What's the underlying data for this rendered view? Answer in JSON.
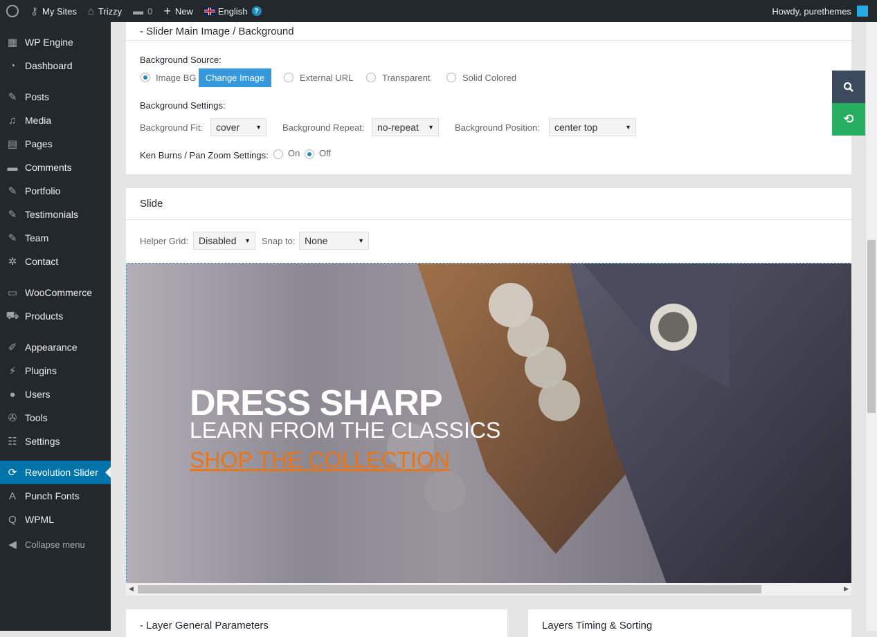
{
  "adminbar": {
    "my_sites": "My Sites",
    "site_name": "Trizzy",
    "comments_count": "0",
    "new_label": "New",
    "language": "English",
    "howdy": "Howdy, purethemes",
    "help": "?"
  },
  "sidebar": {
    "items": [
      {
        "label": "WP Engine",
        "icon": "grid-icon",
        "glyph": "▦"
      },
      {
        "label": "Dashboard",
        "icon": "dashboard-icon",
        "glyph": "◔"
      },
      {
        "label": "Posts",
        "icon": "pin-icon",
        "glyph": "✎"
      },
      {
        "label": "Media",
        "icon": "media-icon",
        "glyph": "♫"
      },
      {
        "label": "Pages",
        "icon": "page-icon",
        "glyph": "▤"
      },
      {
        "label": "Comments",
        "icon": "comment-icon",
        "glyph": "▬"
      },
      {
        "label": "Portfolio",
        "icon": "pin-icon",
        "glyph": "✎"
      },
      {
        "label": "Testimonials",
        "icon": "pin-icon",
        "glyph": "✎"
      },
      {
        "label": "Team",
        "icon": "pin-icon",
        "glyph": "✎"
      },
      {
        "label": "Contact",
        "icon": "gear-icon",
        "glyph": "✲"
      },
      {
        "label": "WooCommerce",
        "icon": "woo-icon",
        "glyph": "▭"
      },
      {
        "label": "Products",
        "icon": "cart-icon",
        "glyph": "⛟"
      },
      {
        "label": "Appearance",
        "icon": "brush-icon",
        "glyph": "✐"
      },
      {
        "label": "Plugins",
        "icon": "plug-icon",
        "glyph": "⚡"
      },
      {
        "label": "Users",
        "icon": "user-icon",
        "glyph": "●"
      },
      {
        "label": "Tools",
        "icon": "wrench-icon",
        "glyph": "✇"
      },
      {
        "label": "Settings",
        "icon": "settings-icon",
        "glyph": "☷"
      },
      {
        "label": "Revolution Slider",
        "icon": "refresh-icon",
        "glyph": "⟳",
        "current": true
      },
      {
        "label": "Punch Fonts",
        "icon": "font-icon",
        "glyph": "A"
      },
      {
        "label": "WPML",
        "icon": "wpml-icon",
        "glyph": "Q"
      },
      {
        "label": "Collapse menu",
        "icon": "collapse-icon",
        "glyph": "◀"
      }
    ]
  },
  "bg_panel": {
    "title": "-  Slider Main Image / Background",
    "source_label": "Background Source:",
    "options": [
      "Image BG",
      "External URL",
      "Transparent",
      "Solid Colored"
    ],
    "change_image": "Change Image",
    "settings_label": "Background Settings:",
    "fit_label": "Background Fit:",
    "fit_value": "cover",
    "repeat_label": "Background Repeat:",
    "repeat_value": "no-repeat",
    "position_label": "Background Position:",
    "position_value": "center top",
    "kenburns_label": "Ken Burns / Pan Zoom Settings:",
    "kb_on": "On",
    "kb_off": "Off"
  },
  "slide_panel": {
    "title": "Slide",
    "helper_grid_label": "Helper Grid:",
    "helper_grid_value": "Disabled",
    "snap_label": "Snap to:",
    "snap_value": "None",
    "caption_title": "DRESS SHARP",
    "caption_sub": "LEARN FROM THE CLASSICS",
    "caption_link": "SHOP THE COLLECTION"
  },
  "layer_panel": {
    "title": "-  Layer General Parameters"
  },
  "timing_panel": {
    "title": "Layers Timing & Sorting"
  },
  "colors": {
    "accent": "#3498db",
    "current_menu": "#0073aa",
    "link_orange": "#e8751a",
    "refresh_green": "#27ae60"
  }
}
